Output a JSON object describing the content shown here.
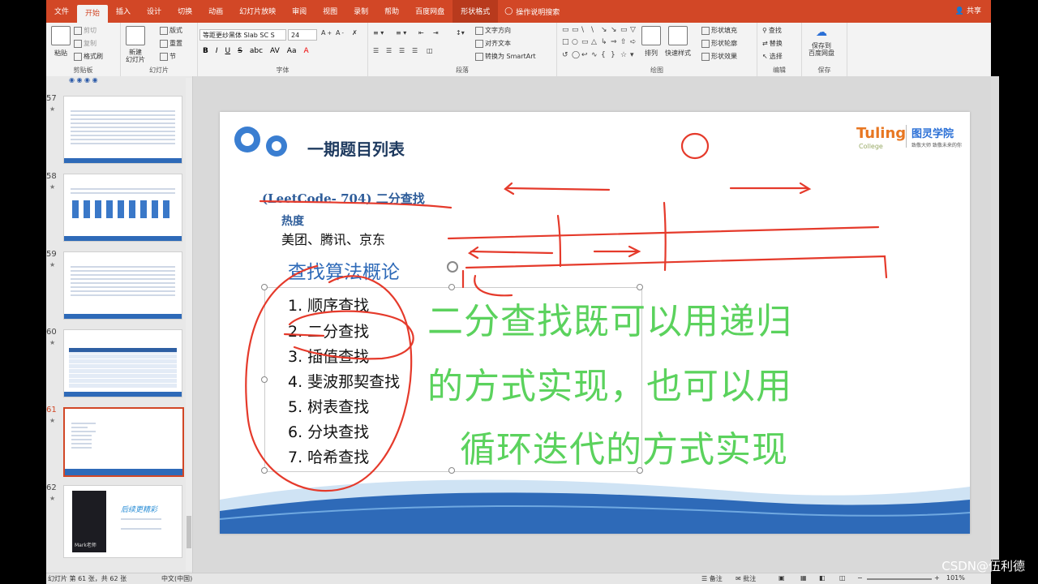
{
  "ribbon_tabs": [
    "文件",
    "开始",
    "插入",
    "设计",
    "切换",
    "动画",
    "幻灯片放映",
    "审阅",
    "视图",
    "录制",
    "帮助",
    "百度网盘",
    "形状格式"
  ],
  "tell_me": "操作说明搜索",
  "share": "共享",
  "clipboard": {
    "paste": "粘贴",
    "cut": "剪切",
    "copy": "复制",
    "format_painter": "格式刷",
    "label": "剪贴板"
  },
  "slides_group": {
    "new_slide": "新建\n幻灯片",
    "layout": "版式",
    "reset": "重置",
    "section": "节",
    "label": "幻灯片"
  },
  "font_group": {
    "font_name": "等距更纱黑体 Slab SC S",
    "font_size": "24",
    "label": "字体",
    "buttons": [
      "B",
      "I",
      "U",
      "S",
      "abc",
      "AV",
      "Aa",
      "A"
    ]
  },
  "paragraph_group": {
    "text_direction": "文字方向",
    "align_text": "对齐文本",
    "convert_smartart": "转换为 SmartArt",
    "label": "段落"
  },
  "drawing_group": {
    "arrange": "排列",
    "quick_styles": "快速样式",
    "shape_fill": "形状填充",
    "shape_outline": "形状轮廓",
    "shape_effects": "形状效果",
    "label": "绘图"
  },
  "editing_group": {
    "find": "查找",
    "replace": "替换",
    "select": "选择",
    "label": "编辑"
  },
  "save_group": {
    "save_to": "保存到\n百度网盘",
    "label": "保存"
  },
  "thumbnails": [
    {
      "num": "57"
    },
    {
      "num": "58"
    },
    {
      "num": "59"
    },
    {
      "num": "60"
    },
    {
      "num": "61"
    },
    {
      "num": "62",
      "title": "后续更精彩",
      "caption": "Mark老师"
    }
  ],
  "slide": {
    "title": "一期题目列表",
    "logo_text": "Tuling",
    "logo_sub": "College",
    "logo_cn": "图灵学院",
    "logo_slogan": "致敬大师 致敬未来的你",
    "subtitle": "(LeetCode- 704) 二分查找",
    "heat_label": "热度",
    "companies": "美团、腾讯、京东",
    "section_title": "查找算法概论",
    "list": [
      "1. 顺序查找",
      "2. 二分查找",
      "3. 插值查找",
      "4. 斐波那契查找",
      "5. 树表查找",
      "6. 分块查找",
      "7. 哈希查找"
    ],
    "overlay_lines": [
      "二分查找既可以用递归",
      "的方式实现，也可以用",
      "循环迭代的方式实现"
    ]
  },
  "status": {
    "slide_info": "幻灯片 第 61 张，共 62 张",
    "language": "中文(中国)",
    "notes": "备注",
    "comments": "批注",
    "zoom": "101%"
  },
  "watermark": "CSDN@伍利德",
  "colors": {
    "accent": "#d24726",
    "ink": "#e53a2b",
    "overlay": "#5bd25d",
    "title": "#2a4d7a"
  }
}
